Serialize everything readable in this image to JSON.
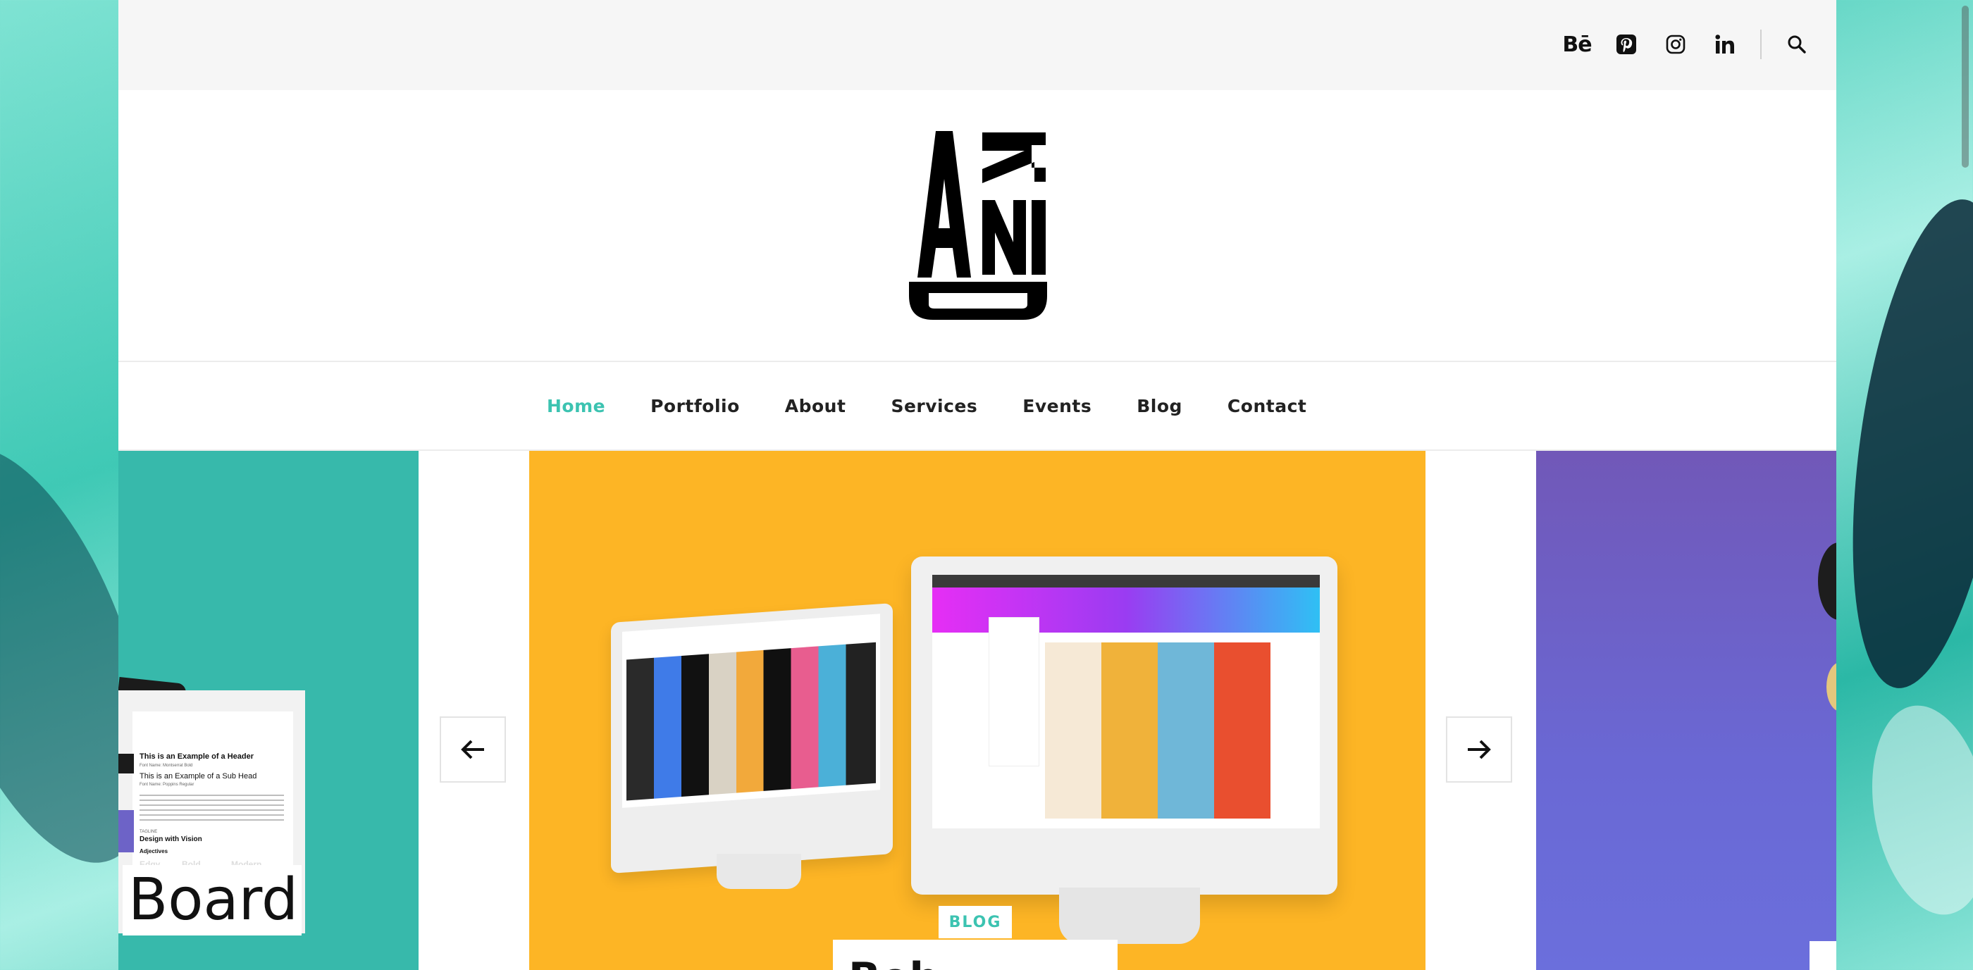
{
  "social": {
    "behance_label": "Bē",
    "items": [
      "behance-icon",
      "pinterest-icon",
      "instagram-icon",
      "linkedin-icon"
    ],
    "search_icon": "search-icon"
  },
  "logo": {
    "alt": "ARNID"
  },
  "nav": {
    "items": [
      {
        "label": "Home",
        "active": true
      },
      {
        "label": "Portfolio",
        "active": false
      },
      {
        "label": "About",
        "active": false
      },
      {
        "label": "Services",
        "active": false
      },
      {
        "label": "Events",
        "active": false
      },
      {
        "label": "Blog",
        "active": false
      },
      {
        "label": "Contact",
        "active": false
      }
    ]
  },
  "slider": {
    "left_slide": {
      "title": "Board",
      "doc_header": "This is an Example of a Header",
      "doc_header_sub": "Font Name: Montserrat Bold",
      "doc_subhead": "This is an Example of a Sub Head",
      "doc_subhead_sub": "Font Name: Poppins Regular",
      "doc_tagline_label": "TAGLINE",
      "doc_tagline": "Design with Vision",
      "doc_adjectives": "Adjectives",
      "doc_words": [
        "Edgy",
        "Bold",
        "Modern"
      ]
    },
    "center_slide": {
      "category": "BLOG",
      "title": "Beh"
    },
    "colors": {
      "left": "#37b9ab",
      "center": "#fdb525",
      "right": "#6b6fdc",
      "accent": "#3cc3b1"
    }
  }
}
